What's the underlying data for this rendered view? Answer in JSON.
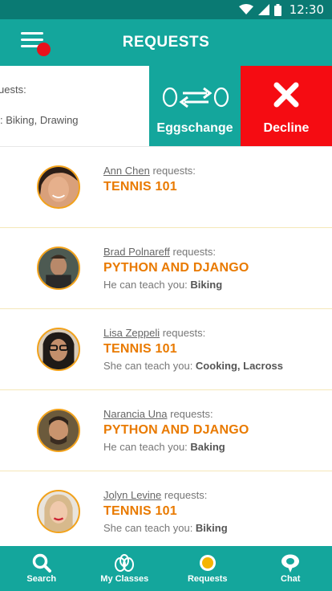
{
  "status_bar": {
    "time": "12:30"
  },
  "app_bar": {
    "title": "REQUESTS"
  },
  "swipe_row": {
    "text_line1": "uests:",
    "text_line2": ": Biking, Drawing",
    "eggschange_label": "Eggschange",
    "decline_label": "Decline"
  },
  "requests": [
    {
      "name": "Ann Chen",
      "verb": " requests:",
      "course": "TENNIS 101",
      "teach_prefix": "",
      "teach_skills": ""
    },
    {
      "name": "Brad Polnareff",
      "verb": " requests:",
      "course": "PYTHON AND DJANGO",
      "teach_prefix": "He can teach you: ",
      "teach_skills": "Biking"
    },
    {
      "name": "Lisa Zeppeli",
      "verb": " requests:",
      "course": "TENNIS 101",
      "teach_prefix": "She can teach you: ",
      "teach_skills": "Cooking, Lacross"
    },
    {
      "name": "Narancia Una",
      "verb": " requests:",
      "course": "PYTHON AND DJANGO",
      "teach_prefix": "He can teach you: ",
      "teach_skills": "Baking"
    },
    {
      "name": "Jolyn Levine",
      "verb": " requests:",
      "course": "TENNIS 101",
      "teach_prefix": "She can teach you: ",
      "teach_skills": "Biking"
    }
  ],
  "bottom_nav": {
    "search": "Search",
    "my_classes": "My Classes",
    "requests": "Requests",
    "chat": "Chat"
  },
  "colors": {
    "primary": "#14a69c",
    "status": "#0a7a73",
    "accent": "#e97a00",
    "decline": "#f50c12",
    "badge": "#e8121b"
  }
}
